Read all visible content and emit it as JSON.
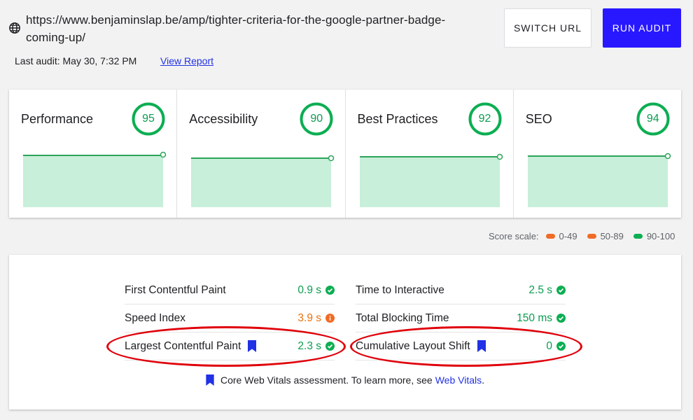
{
  "header": {
    "url": "https://www.benjaminslap.be/amp/tighter-criteria-for-the-google-partner-badge-coming-up/",
    "last_audit": "Last audit: May 30, 7:32 PM",
    "view_report": "View Report",
    "switch_url": "SWITCH URL",
    "run_audit": "RUN AUDIT"
  },
  "categories": [
    {
      "title": "Performance",
      "score": "95"
    },
    {
      "title": "Accessibility",
      "score": "90"
    },
    {
      "title": "Best Practices",
      "score": "92"
    },
    {
      "title": "SEO",
      "score": "94"
    }
  ],
  "score_scale": {
    "label": "Score scale:",
    "ranges": [
      {
        "range": "0-49",
        "color": "#f06b26"
      },
      {
        "range": "50-89",
        "color": "#f06b26"
      },
      {
        "range": "90-100",
        "color": "#0cae52"
      }
    ]
  },
  "metrics": [
    {
      "name": "First Contentful Paint",
      "value": "0.9 s",
      "status": "pass",
      "core": false
    },
    {
      "name": "Time to Interactive",
      "value": "2.5 s",
      "status": "pass",
      "core": false
    },
    {
      "name": "Speed Index",
      "value": "3.9 s",
      "status": "average",
      "core": false
    },
    {
      "name": "Total Blocking Time",
      "value": "150 ms",
      "status": "pass",
      "core": false
    },
    {
      "name": "Largest Contentful Paint",
      "value": "2.3 s",
      "status": "pass",
      "core": true
    },
    {
      "name": "Cumulative Layout Shift",
      "value": "0",
      "status": "pass",
      "core": true
    }
  ],
  "cwv_note": {
    "text": "Core Web Vitals assessment. To learn more, see",
    "link": "Web Vitals",
    "suffix": "."
  },
  "colors": {
    "pass": "#0a9d51",
    "average": "#e8710a",
    "bookmark": "#2131e5",
    "accent": "#2818ff",
    "highlight_ring": "#e0000a"
  }
}
